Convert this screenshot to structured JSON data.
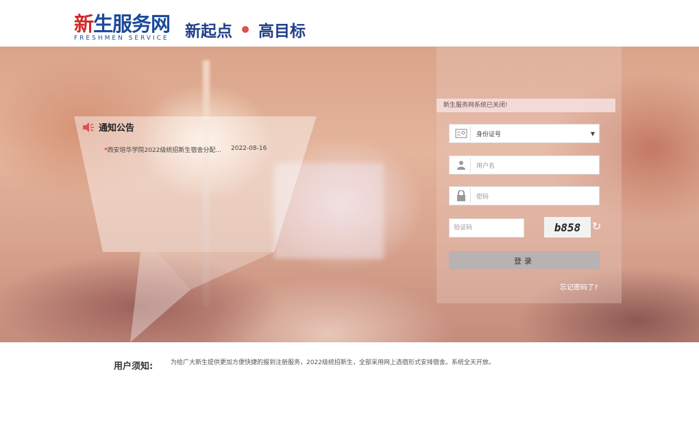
{
  "header": {
    "logo_main_red": "新",
    "logo_main_rest": "生服务网",
    "logo_sub": "FRESHMEN SERVICE",
    "slogan_left": "新起点",
    "slogan_right": "高目标"
  },
  "notice": {
    "title": "通知公告",
    "items": [
      {
        "star": "*",
        "text": "西安培华学院2022级统招新生宿舍分配...",
        "date": "2022-08-16"
      }
    ]
  },
  "login": {
    "closed_message": "新生服务网系统已关闭!",
    "id_type_selected": "身份证号",
    "username_placeholder": "用户名",
    "password_placeholder": "密码",
    "captcha_placeholder": "验证码",
    "captcha_text": "b858",
    "login_label": "登录",
    "forgot_label": "忘记密码了?"
  },
  "footer": {
    "label": "用户须知:",
    "text": "为给广大新生提供更加方便快捷的报到注册服务，2022级统招新生，全部采用网上选宿形式安排宿舍。系统全天开放。"
  },
  "colors": {
    "brand_blue": "#1c4a9a",
    "brand_red": "#d22a2a",
    "dot_red": "#d9534f",
    "login_button": "#b9b2b2"
  }
}
